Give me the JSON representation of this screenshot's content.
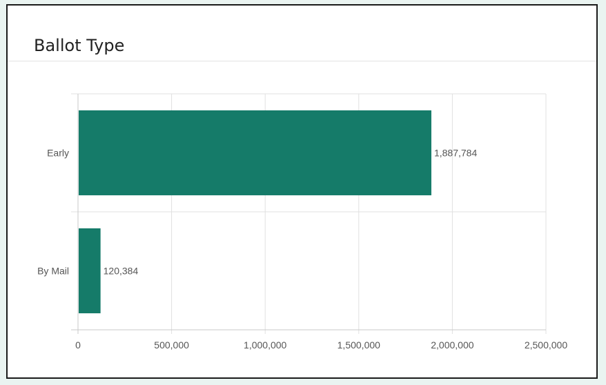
{
  "panel": {
    "title": "Ballot Type"
  },
  "colors": {
    "bar": "#157b69",
    "grid": "#e0e0e0",
    "axis": "#c8c8c8",
    "text": "#555555"
  },
  "chart_data": {
    "type": "bar",
    "orientation": "horizontal",
    "categories": [
      "Early",
      "By Mail"
    ],
    "values": [
      1887784,
      120384
    ],
    "value_labels": [
      "1,887,784",
      "120,384"
    ],
    "x_ticks": [
      0,
      500000,
      1000000,
      1500000,
      2000000,
      2500000
    ],
    "x_tick_labels": [
      "0",
      "500,000",
      "1,000,000",
      "1,500,000",
      "2,000,000",
      "2,500,000"
    ],
    "xlim": [
      0,
      2500000
    ],
    "grid": true,
    "legend": "none",
    "title": "Ballot Type",
    "xlabel": "",
    "ylabel": ""
  }
}
